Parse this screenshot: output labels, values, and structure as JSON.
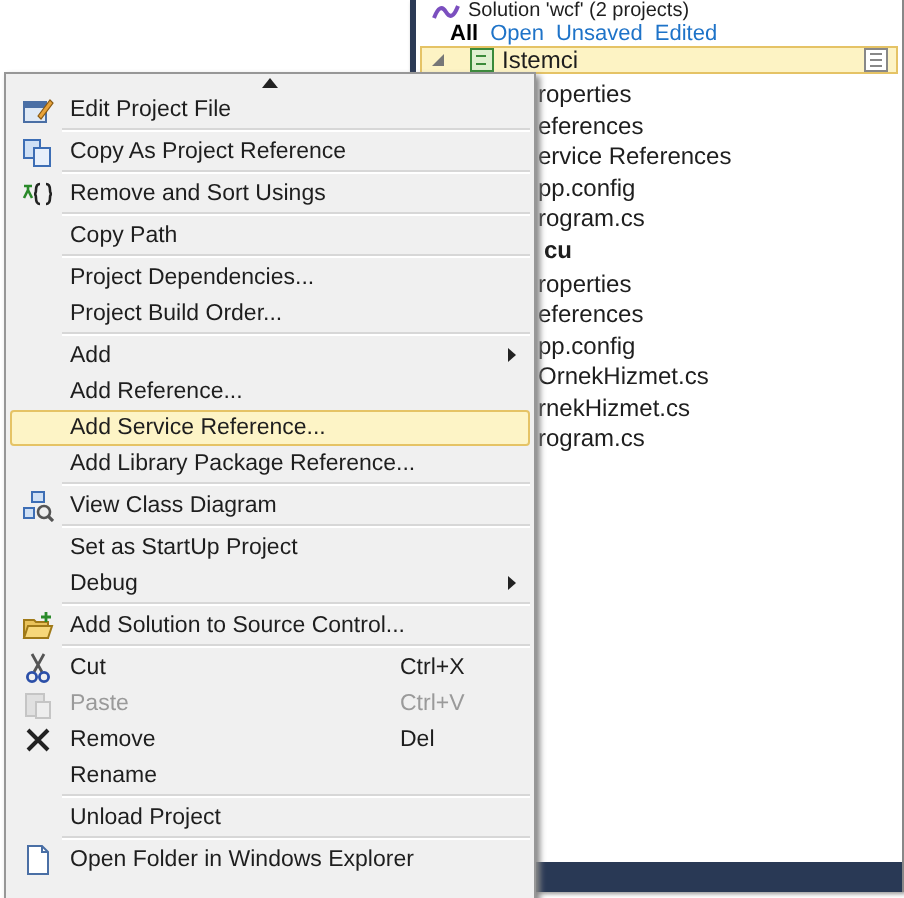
{
  "solution_explorer": {
    "title": "Solution 'wcf' (2 projects)",
    "filters": [
      {
        "label": "All",
        "selected": true
      },
      {
        "label": "Open",
        "selected": false
      },
      {
        "label": "Unsaved",
        "selected": false
      },
      {
        "label": "Edited",
        "selected": false
      }
    ],
    "projects": [
      {
        "label": "Istemci",
        "selected": true,
        "children": [
          {
            "label": "roperties"
          },
          {
            "label": "eferences"
          },
          {
            "label": "ervice References"
          },
          {
            "label": "pp.config"
          },
          {
            "label": "rogram.cs"
          }
        ]
      },
      {
        "label": "cu",
        "selected": false,
        "children": [
          {
            "label": "roperties"
          },
          {
            "label": "eferences"
          },
          {
            "label": "pp.config"
          },
          {
            "label": "OrnekHizmet.cs"
          },
          {
            "label": "rnekHizmet.cs"
          },
          {
            "label": "rogram.cs"
          }
        ]
      }
    ]
  },
  "context_menu": {
    "groups": [
      [
        {
          "label": "Edit Project File",
          "submenu": false,
          "selected": false,
          "disabled": false
        }
      ],
      [
        {
          "label": "Copy As Project Reference",
          "submenu": false,
          "selected": false,
          "disabled": false
        }
      ],
      [
        {
          "label": "Remove and Sort Usings",
          "submenu": false,
          "selected": false,
          "disabled": false
        }
      ],
      [
        {
          "label": "Copy Path",
          "submenu": false,
          "selected": false,
          "disabled": false
        }
      ],
      [
        {
          "label": "Project Dependencies...",
          "submenu": false,
          "selected": false,
          "disabled": false
        },
        {
          "label": "Project Build Order...",
          "submenu": false,
          "selected": false,
          "disabled": false
        }
      ],
      [
        {
          "label": "Add",
          "submenu": true,
          "selected": false,
          "disabled": false
        },
        {
          "label": "Add Reference...",
          "submenu": false,
          "selected": false,
          "disabled": false
        },
        {
          "label": "Add Service Reference...",
          "submenu": false,
          "selected": true,
          "disabled": false
        },
        {
          "label": "Add Library Package Reference...",
          "submenu": false,
          "selected": false,
          "disabled": false
        }
      ],
      [
        {
          "label": "View Class Diagram",
          "submenu": false,
          "selected": false,
          "disabled": false
        }
      ],
      [
        {
          "label": "Set as StartUp Project",
          "submenu": false,
          "selected": false,
          "disabled": false
        },
        {
          "label": "Debug",
          "submenu": true,
          "selected": false,
          "disabled": false
        }
      ],
      [
        {
          "label": "Add Solution to Source Control...",
          "submenu": false,
          "selected": false,
          "disabled": false
        }
      ],
      [
        {
          "label": "Cut",
          "shortcut": "Ctrl+X",
          "submenu": false,
          "selected": false,
          "disabled": false
        },
        {
          "label": "Paste",
          "shortcut": "Ctrl+V",
          "submenu": false,
          "selected": false,
          "disabled": true
        },
        {
          "label": "Remove",
          "shortcut": "Del",
          "submenu": false,
          "selected": false,
          "disabled": false
        },
        {
          "label": "Rename",
          "submenu": false,
          "selected": false,
          "disabled": false
        }
      ],
      [
        {
          "label": "Unload Project",
          "submenu": false,
          "selected": false,
          "disabled": false
        }
      ],
      [
        {
          "label": "Open Folder in Windows Explorer",
          "submenu": false,
          "selected": false,
          "disabled": false
        }
      ]
    ]
  }
}
